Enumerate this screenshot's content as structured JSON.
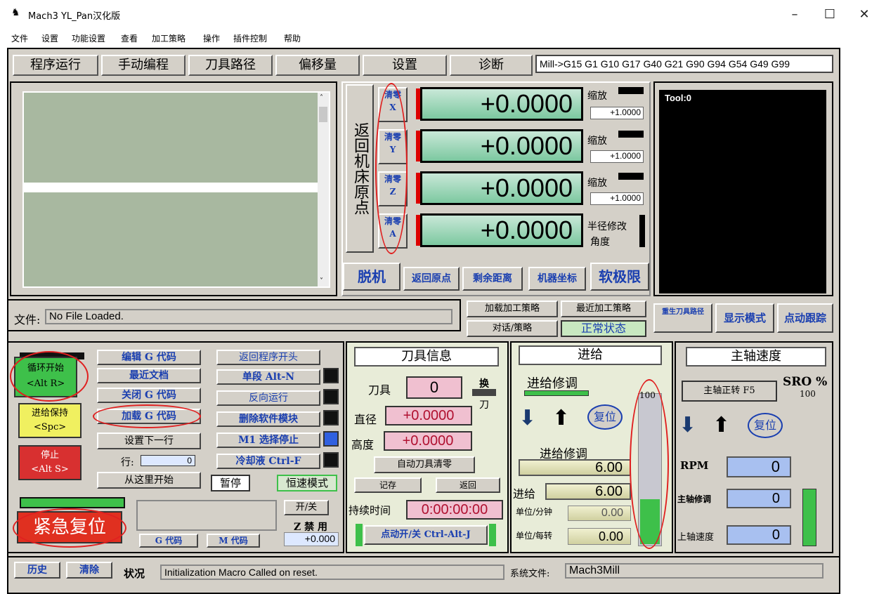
{
  "app": {
    "title": "Mach3 YL_Pan汉化版"
  },
  "menu": [
    "文件",
    "设置",
    "功能设置",
    "查看",
    "加工策略",
    "操作",
    "插件控制",
    "帮助"
  ],
  "tabs": [
    "程序运行",
    "手动编程",
    "刀具路径",
    "偏移量",
    "设置",
    "诊断"
  ],
  "modal_line": "Mill->G15  G1 G10 G17 G40 G21 G90 G94 G54 G49 G99",
  "ref_home": "返回机床原点",
  "axes": [
    {
      "zero_label": "清零",
      "axis": "X",
      "value": "+0.0000",
      "scale_label": "缩放",
      "scale_value": "+1.0000"
    },
    {
      "zero_label": "清零",
      "axis": "Y",
      "value": "+0.0000",
      "scale_label": "缩放",
      "scale_value": "+1.0000"
    },
    {
      "zero_label": "清零",
      "axis": "Z",
      "value": "+0.0000",
      "scale_label": "缩放",
      "scale_value": "+1.0000"
    },
    {
      "zero_label": "清零",
      "axis": "A",
      "value": "+0.0000",
      "scale_label": "半径修改",
      "scale_value": "角度"
    }
  ],
  "dro_buttons": [
    "脱机",
    "返回原点",
    "剩余距离",
    "机器坐标",
    "软极限"
  ],
  "tool_display": "Tool:0",
  "file": {
    "label": "文件:",
    "value": "No File Loaded."
  },
  "strategy": {
    "load": "加载加工策略",
    "recent": "最近加工策略",
    "dialog": "对话/策略",
    "status": "正常状态"
  },
  "right_buttons": [
    "重生刀具路径",
    "显示模式",
    "点动跟踪"
  ],
  "cycle": {
    "start": "循环开始",
    "start_key": "<Alt R>",
    "hold": "进给保持",
    "hold_key": "<Spc>",
    "stop": "停止",
    "stop_key": "<Alt S>"
  },
  "file_buttons": [
    "编辑 G 代码",
    "最近文档",
    "关闭 G 代码",
    "加载 G 代码",
    "设置下一行"
  ],
  "line": {
    "label": "行:",
    "value": "0"
  },
  "run_from_here": "从这里开始",
  "prog_buttons": [
    "返回程序开头",
    "单段 Alt-N",
    "反向运行",
    "删除软件模块",
    "M1 选择停止",
    "冷却液 Ctrl-F"
  ],
  "pause": "暂停",
  "constant_velocity": "恒速模式",
  "emergency": "紧急复位",
  "onoff": "开/关",
  "z_inhibit": "Z 禁 用",
  "z_inhibit_value": "+0.000",
  "gcodes_btn": "G 代码",
  "mcodes_btn": "M 代码",
  "tool_info": {
    "title": "刀具信息",
    "tool_label": "刀具",
    "tool_value": "0",
    "change": "换",
    "change2": "刀",
    "dia_label": "直径",
    "dia_value": "+0.0000",
    "height_label": "高度",
    "height_value": "+0.0000",
    "auto_zero": "自动刀具清零",
    "remember": "记存",
    "return": "返回",
    "elapsed_label": "持续时间",
    "elapsed_value": "0:00:00:00",
    "jog": "点动开/关 Ctrl-Alt-J"
  },
  "feed": {
    "title": "进给",
    "override_label": "进给修调",
    "reset": "复位",
    "override_label2": "进给修调",
    "override_value": "6.00",
    "feed_label": "进给",
    "feed_value": "6.00",
    "per_min_label": "单位/分钟",
    "per_min_value": "0.00",
    "per_rev_label": "单位/每转",
    "per_rev_value": "0.00",
    "percent": "100",
    "percent_fraction": 0.3
  },
  "spindle": {
    "title": "主轴速度",
    "cw": "主轴正转 F5",
    "sro": "SRO %",
    "sro_value": "100",
    "reset": "复位",
    "rpm_label": "RPM",
    "rpm_value": "0",
    "override_label": "主轴修调",
    "override_value": "0",
    "speed_label": "上轴速度",
    "speed_value": "0"
  },
  "status": {
    "history": "历史",
    "clear": "清除",
    "label": "状况",
    "message": "Initialization Macro Called on reset.",
    "profile_label": "系统文件:",
    "profile_value": "Mach3Mill"
  },
  "colors": {
    "ok_green": "#3ec04a",
    "stop_red": "#d83030",
    "yellow": "#f0f060",
    "dro_green": "#9fd8b8",
    "accent_blue": "#1a3fb0"
  }
}
